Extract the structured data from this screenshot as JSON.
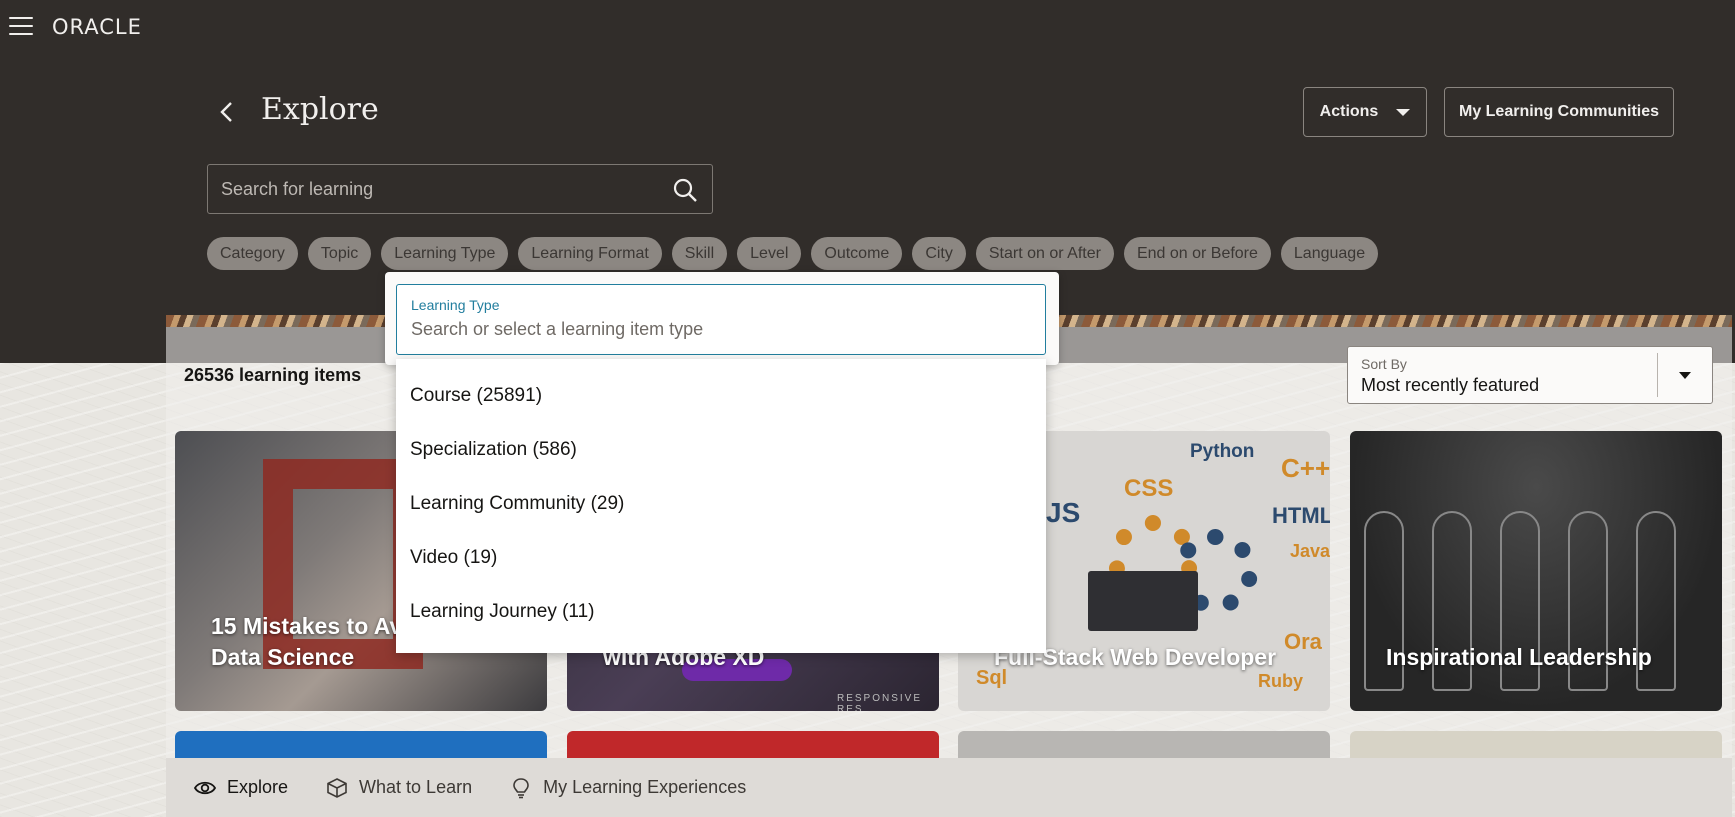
{
  "app": {
    "logo": "ORACLE"
  },
  "header": {
    "title": "Explore",
    "actions_label": "Actions",
    "communities_label": "My Learning Communities",
    "search_placeholder": "Search for learning"
  },
  "filters": [
    "Category",
    "Topic",
    "Learning Type",
    "Learning Format",
    "Skill",
    "Level",
    "Outcome",
    "City",
    "Start on or After",
    "End on or Before",
    "Language"
  ],
  "results": {
    "count_label": "26536 learning items",
    "sort_label": "Sort By",
    "sort_value": "Most recently featured"
  },
  "cards": [
    {
      "title_line1": "15 Mistakes to Av",
      "title_line2": "Data Science"
    },
    {
      "title_line1": "",
      "title_line2": "with Adobe XD"
    },
    {
      "title_line1": "",
      "title_line2": "Full-Stack Web Developer"
    },
    {
      "title_line1": "",
      "title_line2": "Inspirational Leadership"
    }
  ],
  "card3_skills": [
    "Python",
    "CSS",
    "C++",
    "JS",
    "HTML",
    "Java",
    "Ora",
    "Sql",
    "Ruby"
  ],
  "card2_extra": {
    "responsive": "RESPONSIVE RES"
  },
  "bottom_nav": [
    {
      "label": "Explore",
      "icon": "eye-icon",
      "active": true
    },
    {
      "label": "What to Learn",
      "icon": "cube-icon",
      "active": false
    },
    {
      "label": "My Learning Experiences",
      "icon": "lightbulb-icon",
      "active": false
    }
  ],
  "dropdown": {
    "label": "Learning Type",
    "placeholder": "Search or select a learning item type",
    "options": [
      "Course (25891)",
      "Specialization (586)",
      "Learning Community (29)",
      "Video (19)",
      "Learning Journey (11)"
    ]
  },
  "colors": {
    "header_bg": "#312d2a",
    "accent": "#227e9e",
    "chip_bg": "#8c8782"
  }
}
